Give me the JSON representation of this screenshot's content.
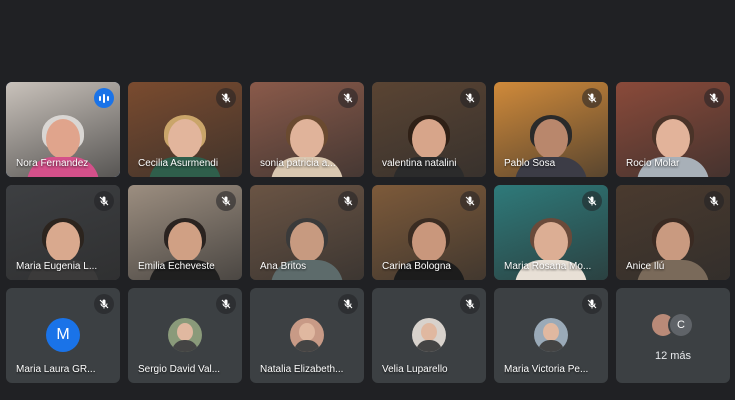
{
  "participants": [
    {
      "name": "Nora Fernandez",
      "status": "speaking",
      "bg": "#c9c2bb",
      "hair": "#d9d6d3",
      "skin": "#e0a48c",
      "shirt": "#d4508a"
    },
    {
      "name": "Cecilia Asurmendi",
      "status": "muted",
      "bg": "#7a4b2f",
      "hair": "#caa56a",
      "skin": "#e2b59c",
      "shirt": "#2f5e4b"
    },
    {
      "name": "sonia patricia a...",
      "status": "muted",
      "bg": "#8a5a4a",
      "hair": "#6a4a30",
      "skin": "#e0b39a",
      "shirt": "#d9c7b0"
    },
    {
      "name": "valentina natalini",
      "status": "muted",
      "bg": "#5a4433",
      "hair": "#2f2016",
      "skin": "#d7a58a",
      "shirt": "#2b2b2b"
    },
    {
      "name": "Pablo Sosa",
      "status": "muted",
      "bg": "#d08a3a",
      "hair": "#2a2a2a",
      "skin": "#b9876c",
      "shirt": "#3c3c46"
    },
    {
      "name": "Rocio Molar",
      "status": "muted",
      "bg": "#8a4a3a",
      "hair": "#4a3328",
      "skin": "#e2b39a",
      "shirt": "#a8b0b8"
    },
    {
      "name": "Maria Eugenia L...",
      "status": "muted",
      "bg": "#3d3f42",
      "hair": "#2c241e",
      "skin": "#d9a98e",
      "shirt": "#3b3a3a"
    },
    {
      "name": "Emilia Echeveste",
      "status": "muted",
      "bg": "#9c8e80",
      "hair": "#2a2320",
      "skin": "#d0a084",
      "shirt": "#1f1f1f"
    },
    {
      "name": "Ana Britos",
      "status": "muted",
      "bg": "#6a5444",
      "hair": "#3a3a3a",
      "skin": "#c79a80",
      "shirt": "#5d6b6b"
    },
    {
      "name": "Carina Bologna",
      "status": "muted",
      "bg": "#7d5a3a",
      "hair": "#3a2c22",
      "skin": "#c9977c",
      "shirt": "#1c1c1c"
    },
    {
      "name": "Maria Rosana Mo...",
      "status": "muted",
      "bg": "#2e7a7a",
      "hair": "#6a4a3a",
      "skin": "#dcae94",
      "shirt": "#e8e0d6"
    },
    {
      "name": "Anice Ilú",
      "status": "muted",
      "bg": "#4a3a2e",
      "hair": "#3a2a22",
      "skin": "#c99a80",
      "shirt": "#7a6a5a"
    },
    {
      "name": "Maria Laura GR...",
      "status": "muted",
      "avatar": "M",
      "avatar_bg": "#1a73e8"
    },
    {
      "name": "Sergio David Val...",
      "status": "muted",
      "avatar_photo": "#8a9a7a"
    },
    {
      "name": "Natalia Elizabeth...",
      "status": "muted",
      "avatar_photo": "#c89a86"
    },
    {
      "name": "Velia Luparello",
      "status": "muted",
      "avatar_photo": "#d8d2cc"
    },
    {
      "name": "Maria Victoria Pe...",
      "status": "muted",
      "avatar_photo": "#9aaab8"
    }
  ],
  "more": {
    "label": "12 más",
    "avatar_letter": "C"
  }
}
